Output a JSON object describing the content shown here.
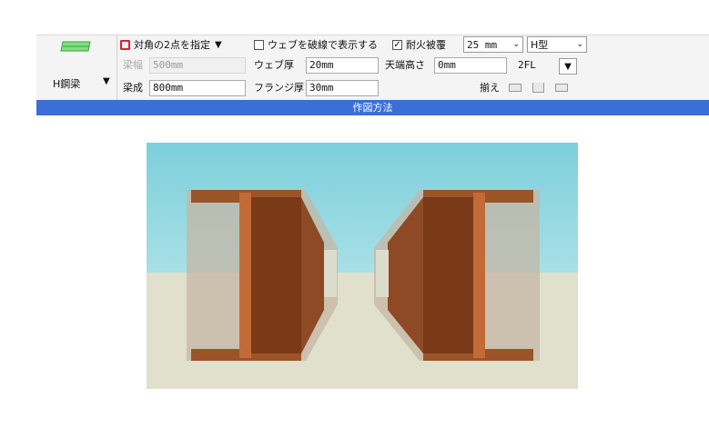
{
  "tool": {
    "label": "H鋼梁",
    "icon": "h-steel-beam-icon"
  },
  "mode": {
    "label": "対角の2点を指定"
  },
  "web_dashed": {
    "label": "ウェブを破線で表示する",
    "checked": false
  },
  "fireproof": {
    "label": "耐火被覆",
    "checked": true,
    "value": "25 mm"
  },
  "section_type": {
    "value": "H型"
  },
  "beam_width": {
    "label": "梁幅",
    "value": "500mm",
    "enabled": false
  },
  "beam_depth": {
    "label": "梁成",
    "value": "800mm"
  },
  "web_thickness": {
    "label": "ウェブ厚",
    "value": "20mm"
  },
  "flange_thickness": {
    "label": "フランジ厚",
    "value": "30mm"
  },
  "top_height": {
    "label": "天端高さ",
    "value": "0mm"
  },
  "floor": {
    "value": "2FL"
  },
  "align": {
    "label": "揃え"
  },
  "caption": "作図方法",
  "colors": {
    "accent": "#3a6fd8",
    "steel": "#8a4a22",
    "fireproof": "#c8b8a8",
    "sky": "#8fd4df",
    "ground": "#e0e0cc"
  }
}
